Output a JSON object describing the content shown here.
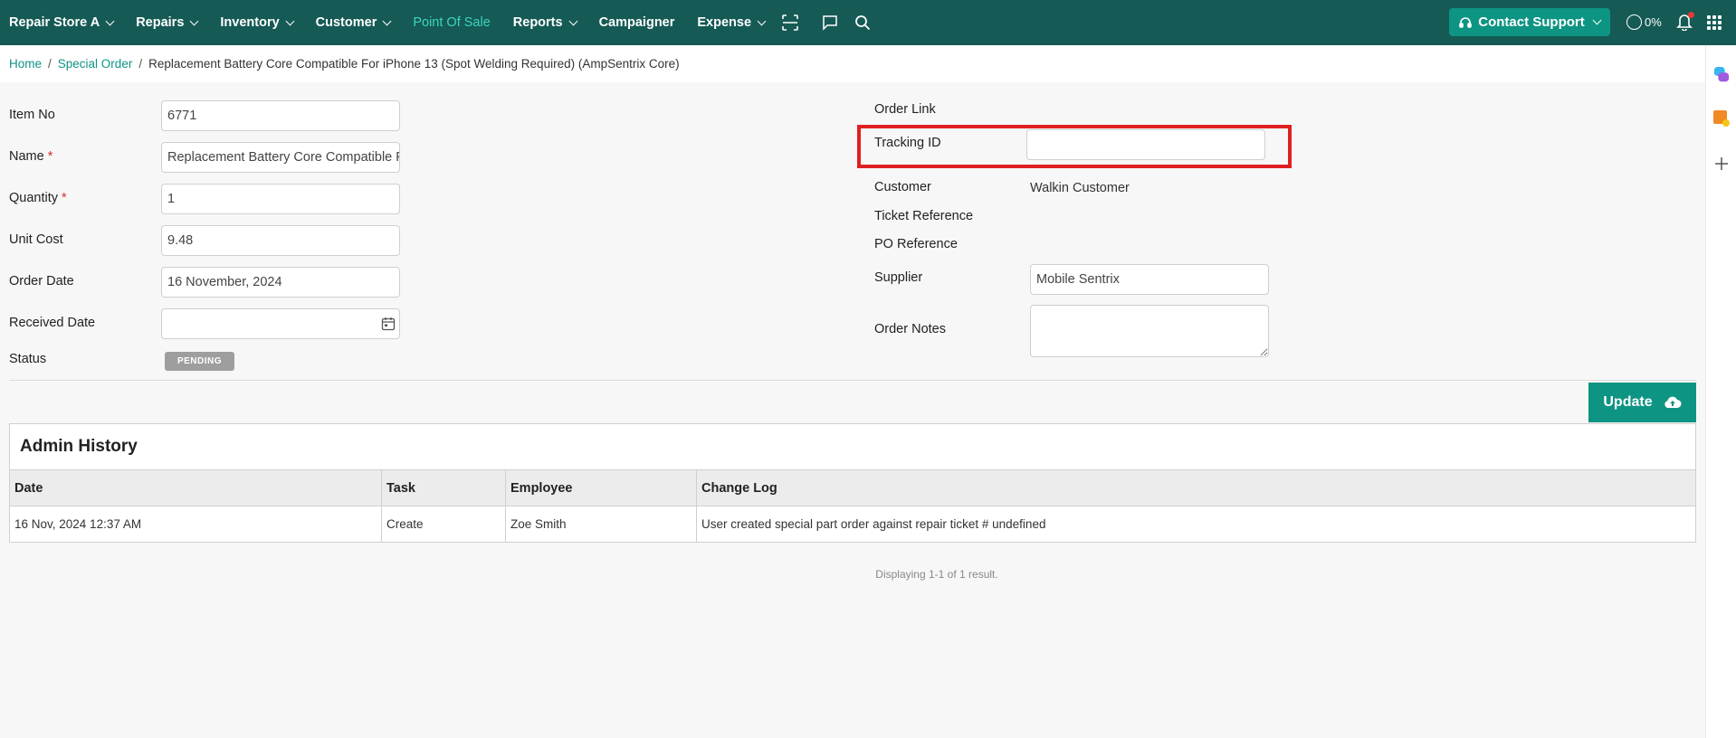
{
  "nav": {
    "items": [
      {
        "label": "Repair Store A",
        "dropdown": true,
        "active": false
      },
      {
        "label": "Repairs",
        "dropdown": true,
        "active": false
      },
      {
        "label": "Inventory",
        "dropdown": true,
        "active": false
      },
      {
        "label": "Customer",
        "dropdown": true,
        "active": false
      },
      {
        "label": "Point Of Sale",
        "dropdown": false,
        "active": true
      },
      {
        "label": "Reports",
        "dropdown": true,
        "active": false
      },
      {
        "label": "Campaigner",
        "dropdown": false,
        "active": false
      },
      {
        "label": "Expense",
        "dropdown": true,
        "active": false
      }
    ],
    "support_label": "Contact Support",
    "progress_label": "0%",
    "colors": {
      "bar": "#155a55",
      "accent": "#0e9482",
      "active_text": "#3dd6c0"
    }
  },
  "breadcrumb": {
    "home": "Home",
    "section": "Special Order",
    "current": "Replacement Battery Core Compatible For iPhone 13 (Spot Welding Required) (AmpSentrix Core)"
  },
  "form": {
    "item_no": {
      "label": "Item No",
      "value": "6771"
    },
    "name": {
      "label": "Name",
      "value": "Replacement Battery Core Compatible For iPhone 13 (Spot Welding Required) (AmpSentrix Core)"
    },
    "quantity": {
      "label": "Quantity",
      "value": "1"
    },
    "unit_cost": {
      "label": "Unit Cost",
      "value": "9.48"
    },
    "order_date": {
      "label": "Order Date",
      "value": "16 November, 2024"
    },
    "received_date": {
      "label": "Received Date",
      "value": ""
    },
    "status": {
      "label": "Status",
      "value": "PENDING"
    },
    "required_mark": "*",
    "order_link": {
      "label": "Order Link"
    },
    "tracking_id": {
      "label": "Tracking ID",
      "value": ""
    },
    "customer": {
      "label": "Customer",
      "value": "Walkin Customer"
    },
    "ticket_reference": {
      "label": "Ticket Reference"
    },
    "po_reference": {
      "label": "PO Reference"
    },
    "supplier": {
      "label": "Supplier",
      "value": "Mobile Sentrix"
    },
    "order_notes": {
      "label": "Order Notes",
      "value": ""
    },
    "update_label": "Update"
  },
  "history": {
    "title": "Admin History",
    "columns": [
      "Date",
      "Task",
      "Employee",
      "Change Log"
    ],
    "rows": [
      [
        "16 Nov, 2024 12:37 AM",
        "Create",
        "Zoe Smith",
        "User created special part order against repair ticket # undefined"
      ]
    ],
    "pagination": "Displaying 1-1 of 1 result."
  }
}
